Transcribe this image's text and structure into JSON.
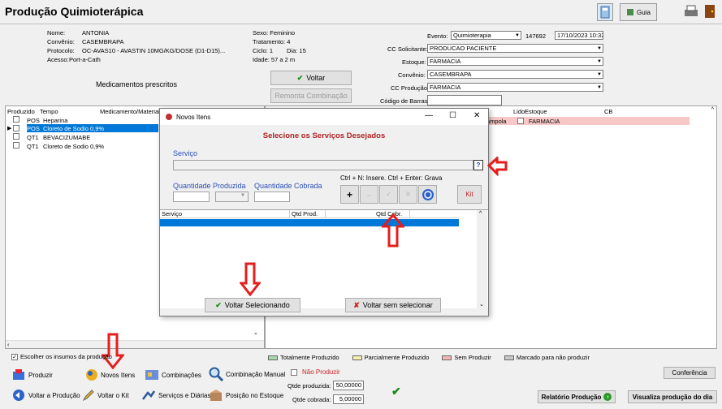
{
  "window_title": "Produção Quimioterápica",
  "top_buttons": {
    "guia": "Guia"
  },
  "patient": {
    "nome_label": "Nome:",
    "nome": "ANTONIA",
    "convenio_label": "Convênio:",
    "convenio": "CASEMBRAPA",
    "protocolo_label": "Protocolo:",
    "protocolo": "OC-AVAS10 - AVASTIN 10MG/KG/DOSE (D1-D15)...",
    "acesso_label": "Acesso:",
    "acesso": "Port-a-Cath",
    "sexo": "Sexo: Feminino",
    "tratamento": "Tratamento: 4",
    "ciclo": "Ciclo: 1",
    "dia": "Dia: 15",
    "idade": "Idade: 57 a 2 m"
  },
  "form": {
    "evento_label": "Evento:",
    "evento": "Quimioterapia",
    "evento_id": "147692",
    "evento_date": "17/10/2023 10:32",
    "cc_solicitante_label": "CC Solicitante:",
    "cc_solicitante": "PRODUCAO PACIENTE",
    "estoque_label": "Estoque:",
    "estoque": "FARMACIA",
    "convenio_label": "Convênio:",
    "convenio": "CASEMBRAPA",
    "cc_producao_label": "CC Produção:",
    "cc_producao": "FARMACIA",
    "codigo_barras_label": "Código de Barras"
  },
  "medicamentos_title": "Medicamentos prescritos",
  "voltar_label": "Voltar",
  "remonta_label": "Remonta Combinação",
  "left_table": {
    "headers": [
      "Produzido",
      "Tempo",
      "Medicamento/Material"
    ],
    "rows": [
      {
        "tempo": "POS",
        "med": "Heparina",
        "selected": false
      },
      {
        "tempo": "POS",
        "med": "Cloreto de Sodio 0,9%",
        "selected": true
      },
      {
        "tempo": "QT1",
        "med": "BEVACIZUMABE",
        "selected": false
      },
      {
        "tempo": "QT1",
        "med": "Cloreto de Sodio 0,9%",
        "selected": false
      }
    ]
  },
  "right_table": {
    "headers": [
      "Lido",
      "Estoque",
      "CB"
    ],
    "row": {
      "extra": "ampola",
      "estoque": "FARMACIA"
    }
  },
  "dialog": {
    "title": "Novos Itens",
    "heading": "Selecione os Serviços Desejados",
    "servico_label": "Serviço",
    "qtd_produzida_label": "Quantidade Produzida",
    "qtd_cobrada_label": "Quantidade Cobrada",
    "shortcut_hint": "Ctrl + N: Insere. Ctrl + Enter: Grava",
    "kit_label": "Kit",
    "grid_headers": [
      "Serviço",
      "Qtd Prod.",
      "",
      "Qtd Cobr."
    ],
    "ok_label": "Voltar Selecionando",
    "cancel_label": "Voltar sem selecionar"
  },
  "escolher_label": "Escolher os insumos da produção",
  "legend": [
    {
      "label": "Totalmente Produzido",
      "color": "#a9d8a9"
    },
    {
      "label": "Parcialmente Produzido",
      "color": "#f5f0b0"
    },
    {
      "label": "Sem Produzir",
      "color": "#f3b8b8"
    },
    {
      "label": "Marcado para não produzir",
      "color": "#c8c8c8"
    }
  ],
  "toolbar": {
    "produzir": "Produzir",
    "novos_itens": "Novos Itens",
    "combinacoes": "Combinações",
    "combinacao_manual": "Combinação Manual",
    "voltar_producao": "Voltar a Produção",
    "voltar_kit": "Voltar o Kit",
    "servicos_diarias": "Serviços e Diárias",
    "posicao_estoque": "Posição no Estoque"
  },
  "nao_produzir_label": "Não Produzir",
  "qtde_produzida_label": "Qtde produzida:",
  "qtde_produzida": "50,00000",
  "qtde_cobrada_label": "Qtde cobrada:",
  "qtde_cobrada": "5,00000",
  "conferencia_label": "Conferência",
  "relatorio_label": "Relatório Produção",
  "visualiza_label": "Visualiza produção do dia"
}
